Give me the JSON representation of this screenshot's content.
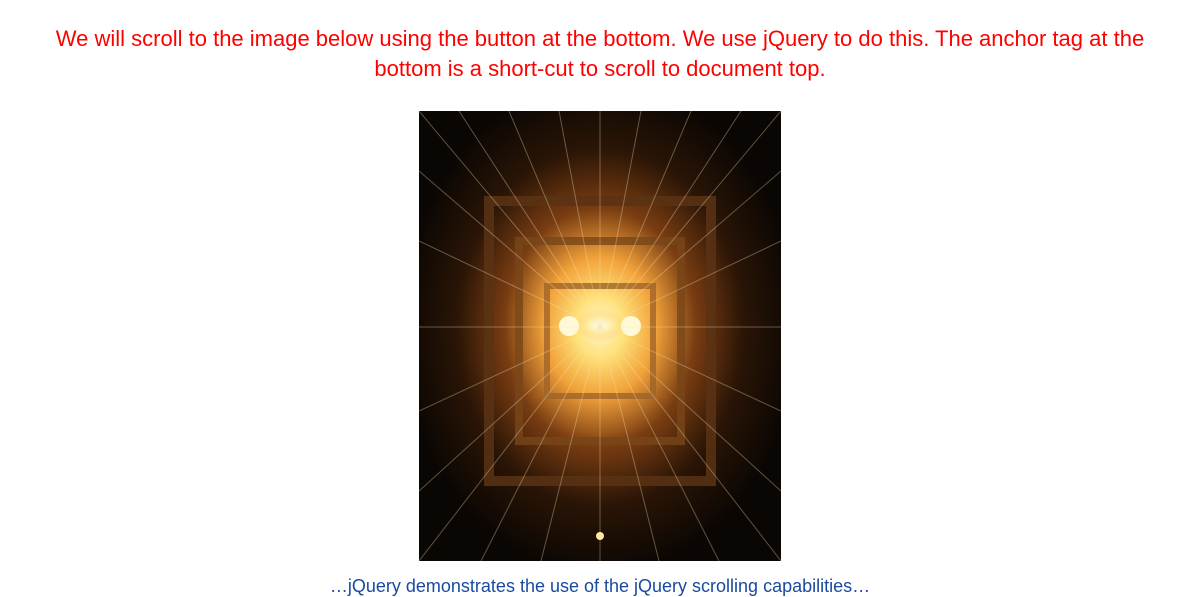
{
  "heading": "We will scroll to the image below using the button at the bottom. We use jQuery to do this. The anchor tag at the bottom is a short-cut to scroll to document top.",
  "image_alt": "abstract-light-perspective-image",
  "below_text_fragment": "…jQuery demonstrates the use of the jQuery scrolling capabilities…"
}
